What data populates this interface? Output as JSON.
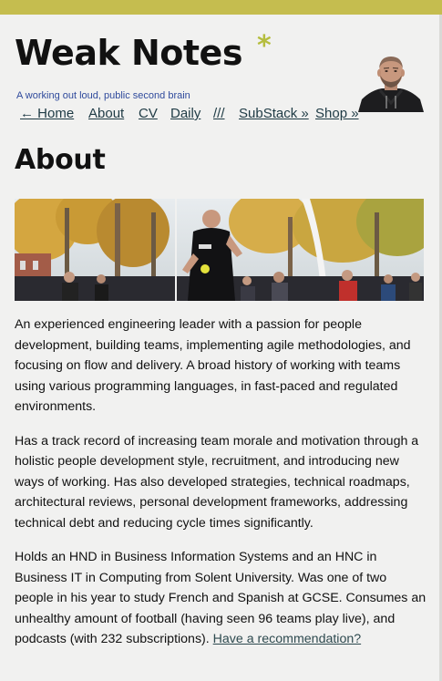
{
  "site": {
    "title": "Weak Notes",
    "asterisk": "*",
    "tagline": "A working out loud, public second brain"
  },
  "nav": {
    "items": [
      "← Home",
      "About",
      "CV",
      "Daily",
      "///",
      "SubStack »",
      "Shop »"
    ]
  },
  "page": {
    "heading": "About",
    "paragraphs": [
      "An experienced engineering leader with a passion for people development, building teams, implementing agile methodologies, and focusing on flow and delivery. A broad history of working with teams using various programming languages, in fast-paced and regulated environments.",
      "Has a track record of increasing team morale and motivation through a holistic people development style, recruitment, and introducing new ways of working. Has also developed strategies, technical roadmaps, architectural reviews, personal development frameworks, addressing technical debt and reducing cycle times significantly.",
      "Holds an HND in Business Information Systems and an HNC in Business IT in Computing from Solent University. Was one of two people in his year to study French and Spanish at GCSE. Consumes an unhealthy amount of football (having seen 96 teams play live), and podcasts (with 232 subscriptions)."
    ],
    "recommendation_link": "Have a recommendation?"
  },
  "colors": {
    "top_bar": "#c5bd4f",
    "asterisk": "#b5bd3e",
    "tagline": "#2f4a9c",
    "link": "#1e3a44",
    "background": "#f1f1f0"
  }
}
